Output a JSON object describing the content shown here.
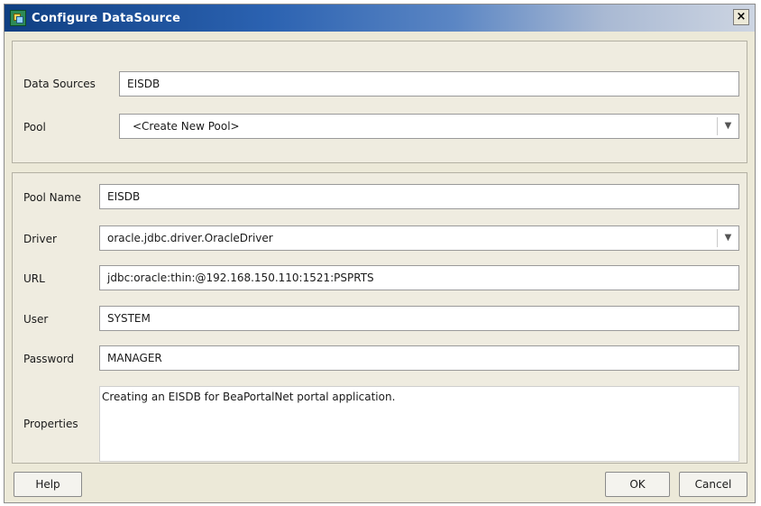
{
  "window": {
    "title": "Configure DataSource",
    "close_label": "×"
  },
  "datasource_section": {
    "data_sources_label": "Data Sources",
    "data_sources_value": "EISDB",
    "pool_label": "Pool",
    "pool_value": "<Create New Pool>"
  },
  "pool_section": {
    "pool_name_label": "Pool Name",
    "pool_name_value": "EISDB",
    "driver_label": "Driver",
    "driver_value": "oracle.jdbc.driver.OracleDriver",
    "url_label": "URL",
    "url_value": "jdbc:oracle:thin:@192.168.150.110:1521:PSPRTS",
    "user_label": "User",
    "user_value": "SYSTEM",
    "password_label": "Password",
    "password_value": "MANAGER",
    "properties_label": "Properties",
    "properties_value": "Creating an EISDB for BeaPortalNet portal application."
  },
  "buttons": {
    "help": "Help",
    "ok": "OK",
    "cancel": "Cancel"
  },
  "icons": {
    "app": "datasource-icon",
    "dropdown": "chevron-down-icon"
  }
}
